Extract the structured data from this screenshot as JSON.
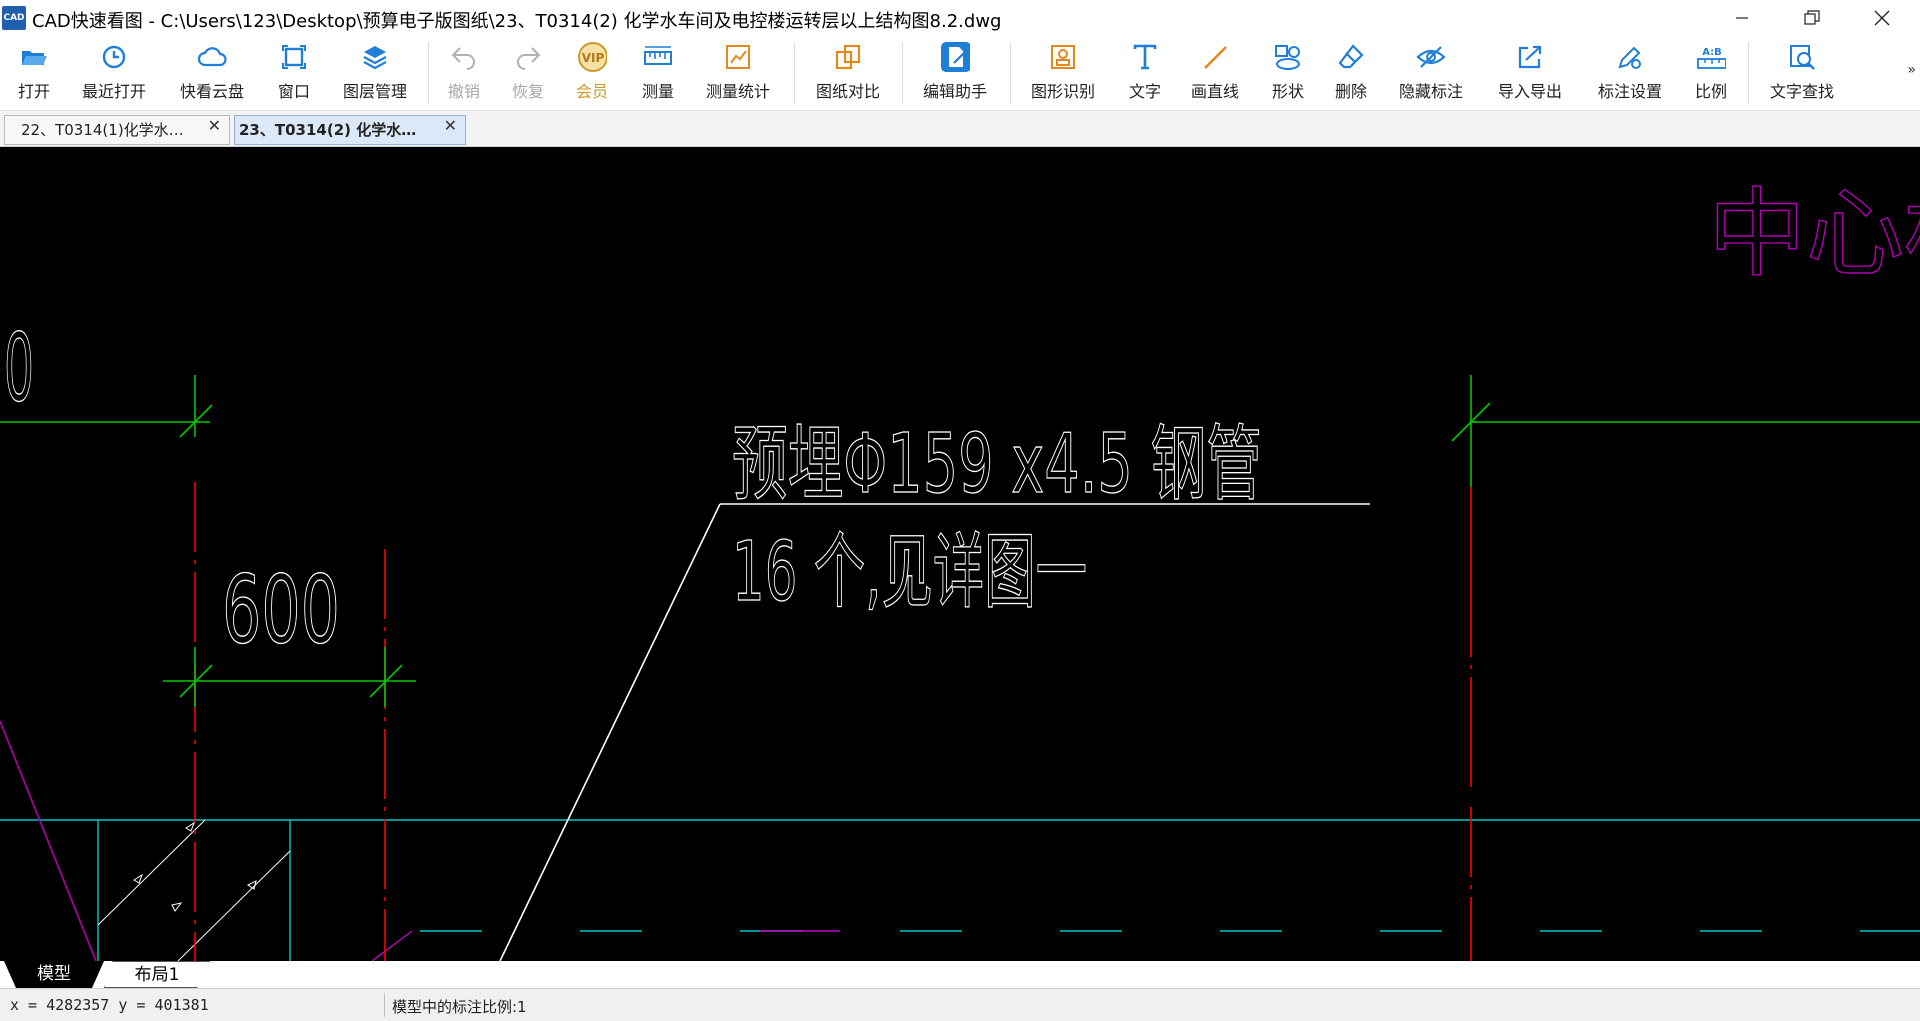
{
  "window": {
    "title": "CAD快速看图 - C:\\Users\\123\\Desktop\\预算电子版图纸\\23、T0314(2) 化学水车间及电控楼运转层以上结构图8.2.dwg",
    "logo_text": "CAD"
  },
  "toolbar": [
    {
      "label": "打开",
      "icon": "folder-open-icon"
    },
    {
      "label": "最近打开",
      "icon": "recent-clock-icon"
    },
    {
      "label": "快看云盘",
      "icon": "cloud-icon"
    },
    {
      "label": "窗口",
      "icon": "window-icon"
    },
    {
      "label": "图层管理",
      "icon": "layers-icon"
    },
    {
      "label": "撤销",
      "icon": "undo-icon",
      "disabled": true
    },
    {
      "label": "恢复",
      "icon": "redo-icon",
      "disabled": true
    },
    {
      "label": "会员",
      "icon": "vip-badge-icon"
    },
    {
      "label": "测量",
      "icon": "ruler-icon"
    },
    {
      "label": "测量统计",
      "icon": "measure-stats-icon"
    },
    {
      "label": "图纸对比",
      "icon": "compare-icon"
    },
    {
      "label": "编辑助手",
      "icon": "edit-assistant-icon"
    },
    {
      "label": "图形识别",
      "icon": "shape-recognition-icon"
    },
    {
      "label": "文字",
      "icon": "text-icon"
    },
    {
      "label": "画直线",
      "icon": "line-icon"
    },
    {
      "label": "形状",
      "icon": "shapes-icon"
    },
    {
      "label": "删除",
      "icon": "eraser-icon"
    },
    {
      "label": "隐藏标注",
      "icon": "hide-eye-icon"
    },
    {
      "label": "导入导出",
      "icon": "import-export-icon"
    },
    {
      "label": "标注设置",
      "icon": "annotation-settings-icon"
    },
    {
      "label": "比例",
      "icon": "scale-ab-icon"
    },
    {
      "label": "文字查找",
      "icon": "text-search-icon"
    }
  ],
  "tabs": [
    {
      "label": "22、T0314(1)化学水…",
      "active": false
    },
    {
      "label": "23、T0314(2) 化学水…",
      "active": true
    }
  ],
  "drawing": {
    "annotation_line1": "预埋Φ159 x4.5 钢管",
    "annotation_line2": "16 个,见详图一",
    "dimension": "600",
    "corner_text": "中心标高",
    "edge_text": "0"
  },
  "layout_tabs": {
    "model": "模型",
    "layout1": "布局1"
  },
  "status": {
    "coords": "x = 4282357 y = 401381",
    "scale": "模型中的标注比例:1"
  },
  "colors": {
    "accent": "#1f7fd6",
    "canvas": "#000000",
    "green": "#00c800",
    "red": "#ff0000",
    "cyan": "#00c8c8",
    "magenta": "#b000b0"
  }
}
